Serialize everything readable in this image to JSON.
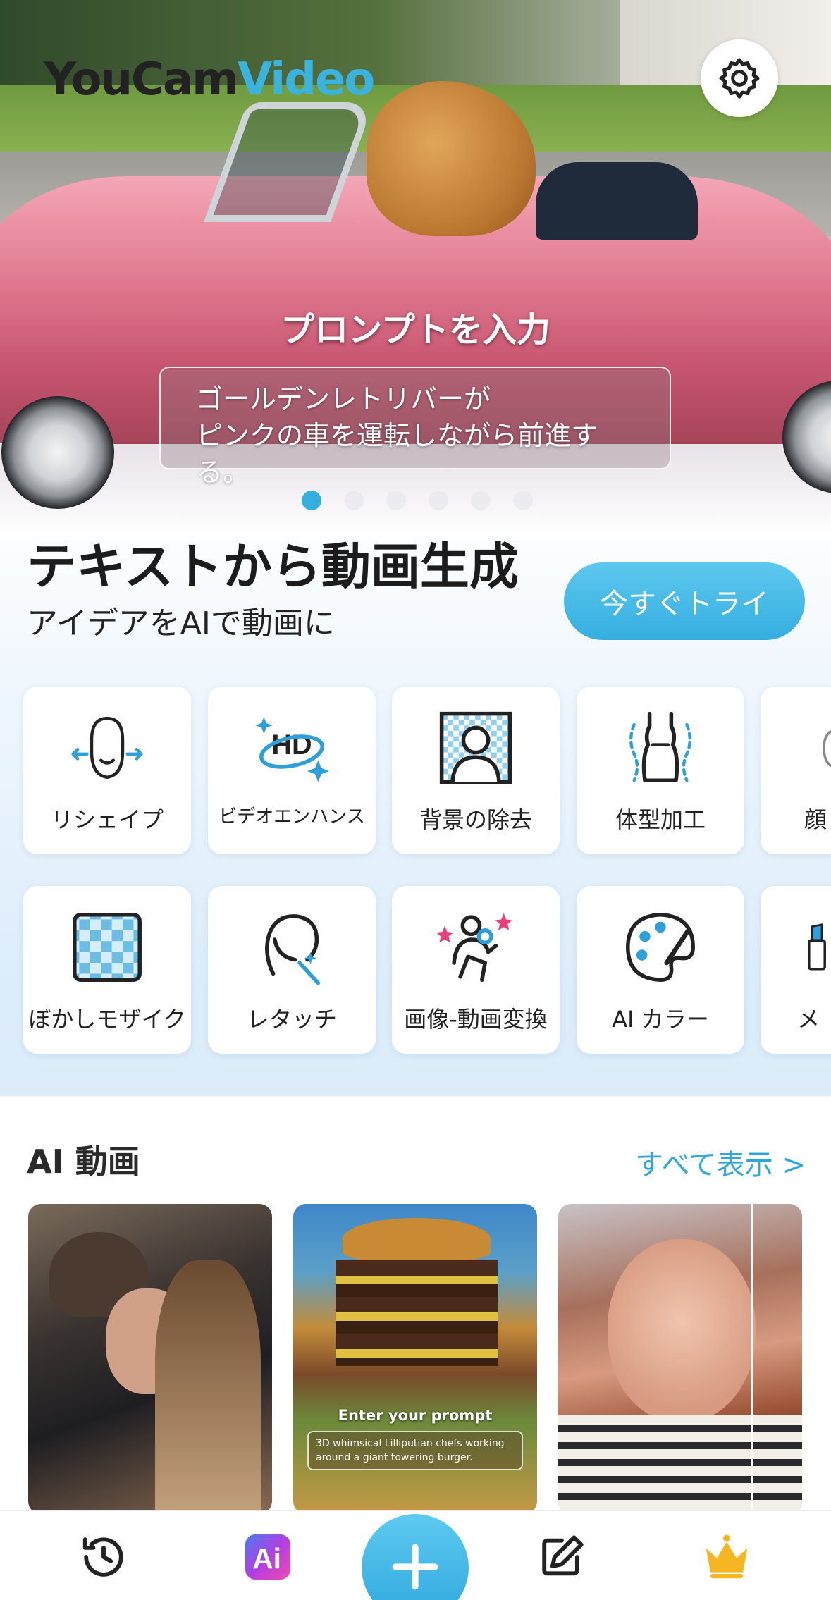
{
  "app": {
    "logo_text_a": "YouCam",
    "logo_text_b": "Video"
  },
  "hero": {
    "prompt_title": "プロンプトを入力",
    "prompt_line1": "ゴールデンレトリバーが",
    "prompt_line2": "ピンクの車を運転しながら前進する。",
    "page_count": 6,
    "active_page": 1
  },
  "promo": {
    "title": "テキストから動画生成",
    "subtitle": "アイデアをAIで動画に",
    "try_label": "今すぐトライ"
  },
  "tools_row1": [
    {
      "label": "リシェイプ",
      "icon": "reshape-face-icon"
    },
    {
      "label": "ビデオエンハンス",
      "icon": "hd-enhance-icon"
    },
    {
      "label": "背景の除去",
      "icon": "remove-background-icon"
    },
    {
      "label": "体型加工",
      "icon": "body-shape-icon"
    },
    {
      "label": "顔",
      "icon": "face-icon"
    }
  ],
  "tools_row2": [
    {
      "label": "ぼかしモザイク",
      "icon": "mosaic-icon"
    },
    {
      "label": "レタッチ",
      "icon": "retouch-icon"
    },
    {
      "label": "画像-動画変換",
      "icon": "image-to-video-icon"
    },
    {
      "label": "AI カラー",
      "icon": "palette-icon"
    },
    {
      "label": "メ",
      "icon": "makeup-icon"
    }
  ],
  "ai_video": {
    "title": "AI 動画",
    "see_all": "すべて表示 >",
    "card2_prompt_title": "Enter your prompt",
    "card2_prompt_text": "3D whimsical Lilliputian chefs working around a giant towering burger."
  },
  "nav": {
    "items": [
      "history-icon",
      "ai-icon",
      "add-icon",
      "edit-icon",
      "premium-crown-icon"
    ]
  },
  "colors": {
    "accent": "#35aee0",
    "crown": "#f5b623"
  }
}
